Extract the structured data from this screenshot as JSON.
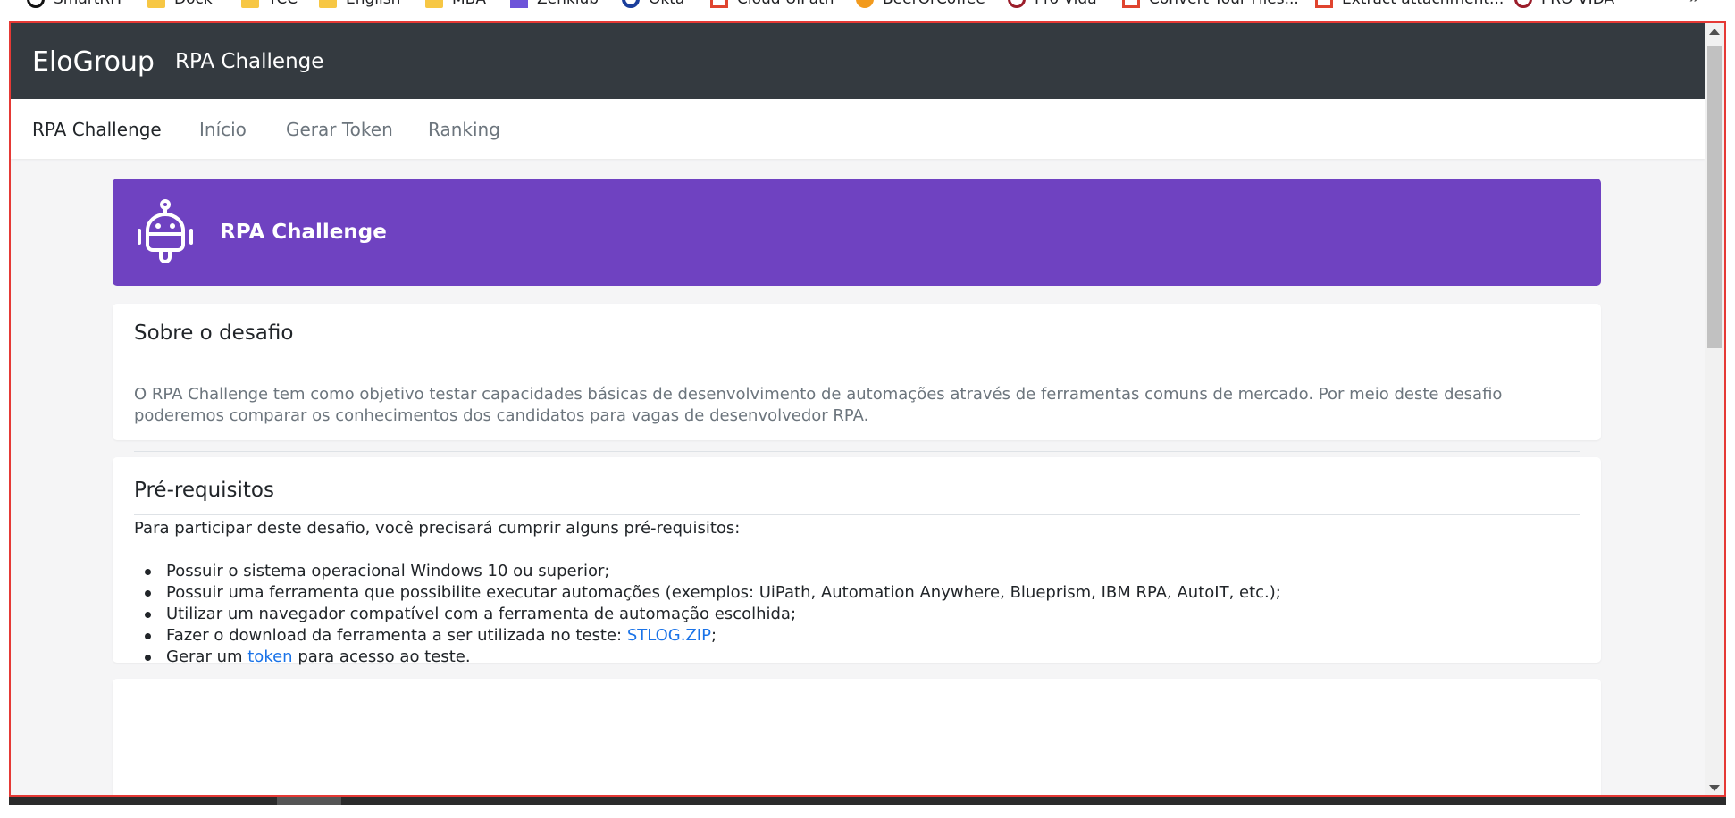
{
  "bookmarks": [
    "SmartRH",
    "Dock",
    "TCC",
    "English",
    "MBA",
    "Zenklub",
    "Okta",
    "Cloud UiPath",
    "BeerOrCoffee",
    "Pro-Vida",
    "Convert Your Files...",
    "Extract attachment...",
    "PRO-VIDA"
  ],
  "header": {
    "brand": "EloGroup",
    "title": "RPA Challenge"
  },
  "nav": {
    "items": [
      "RPA Challenge",
      "Início",
      "Gerar Token",
      "Ranking"
    ],
    "active": "RPA Challenge"
  },
  "hero": {
    "icon": "robot-icon",
    "title": "RPA Challenge",
    "color": "#6f42c1"
  },
  "about": {
    "heading": "Sobre o desafio",
    "text": "O RPA Challenge tem como objetivo testar capacidades básicas de desenvolvimento de automações através de ferramentas comuns de mercado. Por meio deste desafio poderemos comparar os conhecimentos dos candidatos para vagas de desenvolvedor RPA."
  },
  "prereq": {
    "heading": "Pré-requisitos",
    "intro": "Para participar deste desafio, você precisará cumprir alguns pré-requisitos:",
    "items": [
      "Possuir o sistema operacional Windows 10 ou superior;",
      "Possuir uma ferramenta que possibilite executar automações (exemplos: UiPath, Automation Anywhere, Blueprism, IBM RPA, AutoIT, etc.);",
      "Utilizar um navegador compatível com a ferramenta de automação escolhida;"
    ],
    "download_prefix": "Fazer o download da ferramenta a ser utilizada no teste: ",
    "download_link": "STLOG.ZIP",
    "download_suffix": ";",
    "token_prefix": "Gerar um ",
    "token_link": "token",
    "token_suffix": " para acesso ao teste."
  },
  "colors": {
    "topbar": "#343a40",
    "accent": "#6f42c1",
    "link": "#1a73e8",
    "frame": "#e53935"
  }
}
